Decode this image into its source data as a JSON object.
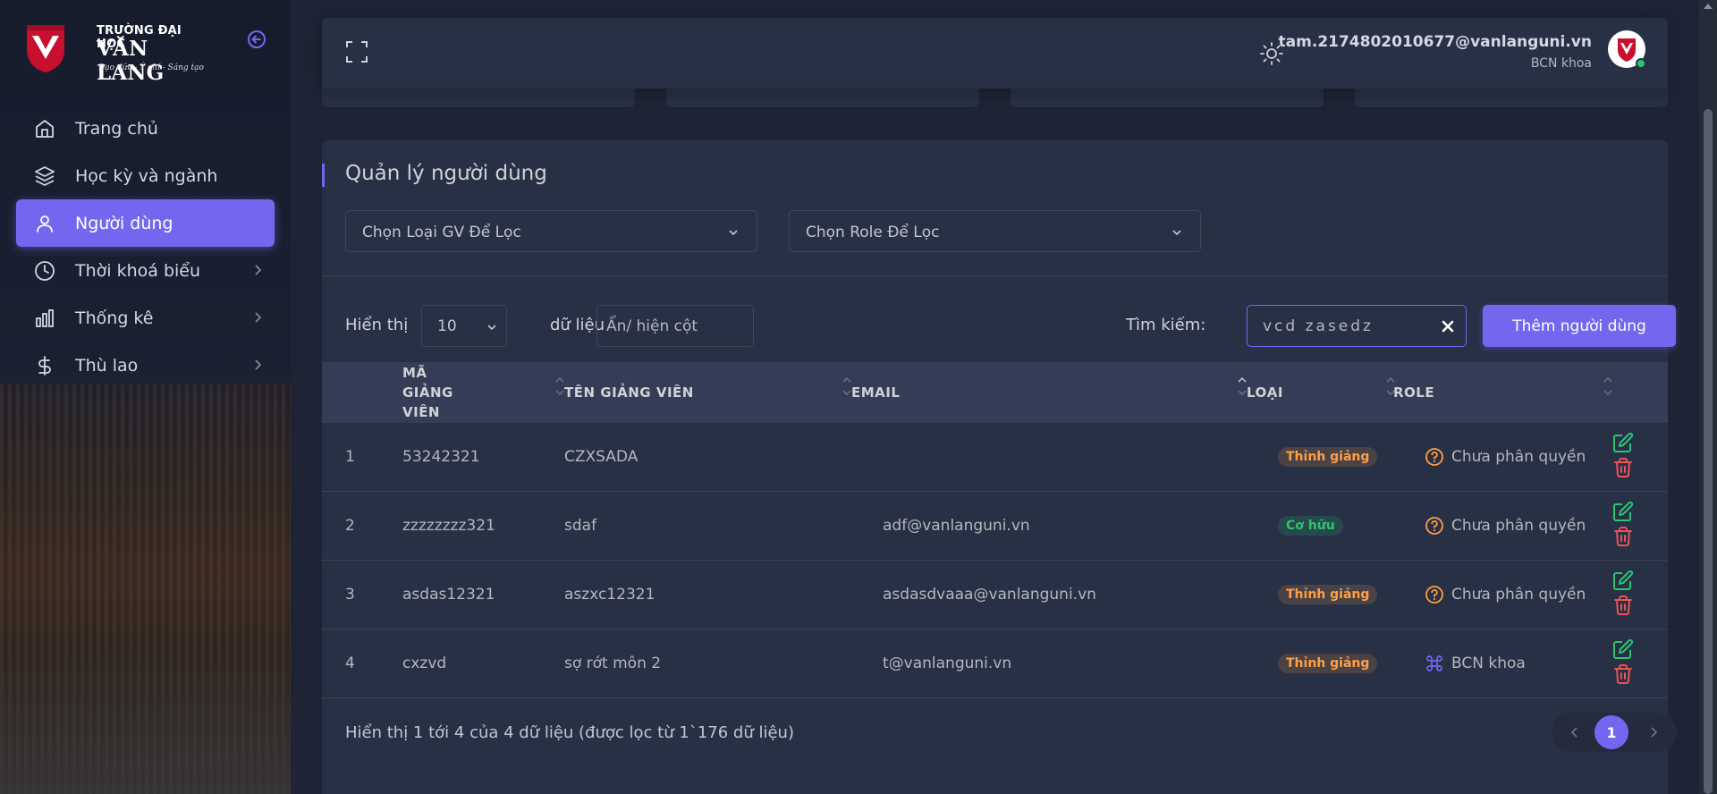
{
  "brand": {
    "line1": "TRƯỜNG ĐẠI HỌC",
    "line2": "VĂN LANG",
    "slogan": "Đạo đức - Ý chí - Sáng tạo",
    "color": "#c8102e"
  },
  "sidebar": {
    "items": [
      {
        "label": "Trang chủ",
        "icon": "home-icon"
      },
      {
        "label": "Học kỳ và ngành",
        "icon": "layers-icon"
      },
      {
        "label": "Người dùng",
        "icon": "user-icon",
        "active": true
      },
      {
        "label": "Thời khoá biểu",
        "icon": "clock-icon",
        "has_submenu": true
      },
      {
        "label": "Thống kê",
        "icon": "bar-chart-icon",
        "has_submenu": true
      },
      {
        "label": "Thù lao",
        "icon": "dollar-icon",
        "has_submenu": true
      }
    ]
  },
  "header": {
    "user_email": "tam.2174802010677@vanlanguni.vn",
    "user_role": "BCN khoa"
  },
  "page": {
    "title": "Quản lý người dùng",
    "filter_type_placeholder": "Chọn Loại GV Để Lọc",
    "filter_role_placeholder": "Chọn Role Để Lọc",
    "show_label": "Hiển thị",
    "page_length": "10",
    "records_label": "dữ liệu",
    "column_toggle": "Ẩn/ hiện cột",
    "search_label": "Tìm kiếm:",
    "search_value": "vcd zasedz",
    "add_button": "Thêm người dùng"
  },
  "table": {
    "headers": [
      "MÃ GIẢNG VIÊN",
      "TÊN GIẢNG VIÊN",
      "EMAIL",
      "LOẠI",
      "ROLE"
    ],
    "rows": [
      {
        "no": "1",
        "code": "53242321",
        "name": "CZXSADA",
        "email": "",
        "type": "Thỉnh giảng",
        "type_color": "orange",
        "role": "Chưa phân quyền",
        "role_icon": "help-circle-icon"
      },
      {
        "no": "2",
        "code": "zzzzzzzz321",
        "name": "sdaf",
        "email": "adf@vanlanguni.vn",
        "type": "Cơ hữu",
        "type_color": "green",
        "role": "Chưa phân quyền",
        "role_icon": "help-circle-icon"
      },
      {
        "no": "3",
        "code": "asdas12321",
        "name": "aszxc12321",
        "email": "asdasdvaaa@vanlanguni.vn",
        "type": "Thỉnh giảng",
        "type_color": "orange",
        "role": "Chưa phân quyền",
        "role_icon": "help-circle-icon"
      },
      {
        "no": "4",
        "code": "cxzvd",
        "name": "sợ rớt môn 2",
        "email": "t@vanlanguni.vn",
        "type": "Thỉnh giảng",
        "type_color": "orange",
        "role": "BCN khoa",
        "role_icon": "command-icon"
      }
    ]
  },
  "footer": {
    "info": "Hiển thị 1 tới 4 của 4 dữ liệu (được lọc từ 1`176 dữ liệu)",
    "current_page": "1"
  },
  "colors": {
    "accent": "#7367f0",
    "success": "#28c76f",
    "warning": "#ff9f43",
    "danger": "#ea5455"
  }
}
